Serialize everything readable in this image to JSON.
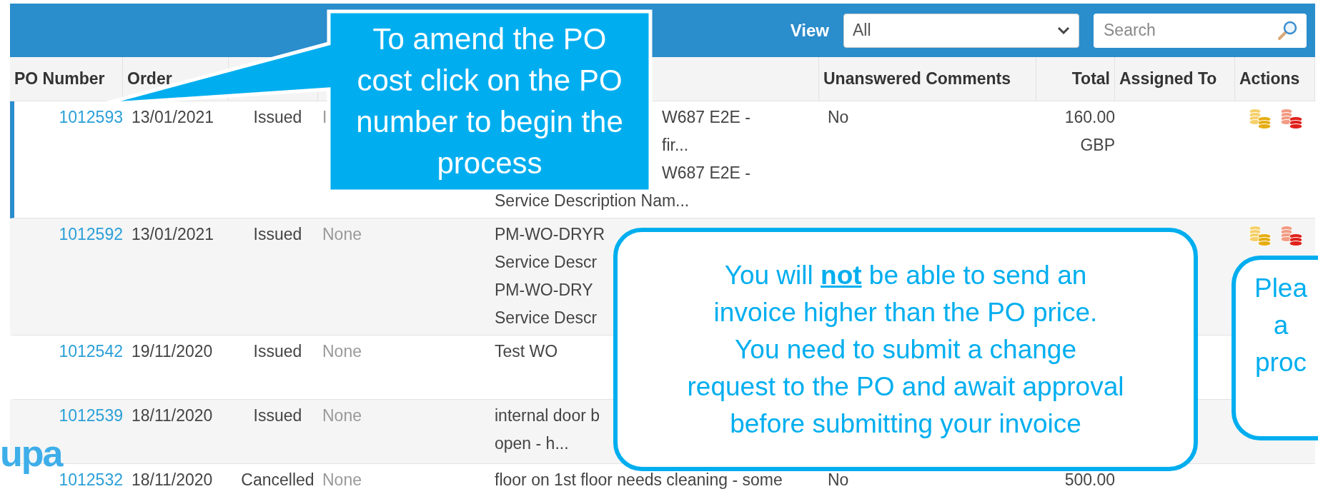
{
  "toolbar": {
    "view_label": "View",
    "view_select": {
      "value": "All"
    },
    "search": {
      "placeholder": "Search"
    }
  },
  "table": {
    "header": {
      "po_number": "PO Number",
      "order_date": "Order",
      "unanswered_comments": "Unanswered Comments",
      "total": "Total",
      "assigned_to": "Assigned To",
      "actions": "Actions"
    },
    "rows": [
      {
        "selected": true,
        "po_number": "1012593",
        "order_date": "13/01/2021",
        "status": "Issued",
        "column_4": "I",
        "description": [
          {
            "text": "W687 E2E -",
            "partly_hidden": true
          },
          {
            "text": "fir...",
            "partly_hidden": true
          },
          {
            "text": "W687 E2E -",
            "partly_hidden": true
          },
          {
            "text": "Service Description Nam...",
            "partly_hidden": false
          }
        ],
        "unanswered_comments": "No",
        "total": "160.00 GBP",
        "actions": [
          {
            "kind": "coins-gold"
          },
          {
            "kind": "coins-red"
          }
        ]
      },
      {
        "selected": false,
        "po_number": "1012592",
        "order_date": "13/01/2021",
        "status": "Issued",
        "column_4": "None",
        "description": [
          {
            "text": "PM-WO-DRYR",
            "partly_hidden": false
          },
          {
            "text": "Service Descr",
            "partly_hidden": false
          },
          {
            "text": "PM-WO-DRY",
            "partly_hidden": false
          },
          {
            "text": "Service Descr",
            "partly_hidden": false
          }
        ],
        "actions": [
          {
            "kind": "coins-gold"
          },
          {
            "kind": "coins-red"
          }
        ]
      },
      {
        "selected": false,
        "po_number": "1012542",
        "order_date": "19/11/2020",
        "status": "Issued",
        "column_4": "None",
        "description": [
          {
            "text": "Test WO",
            "partly_hidden": false
          }
        ]
      },
      {
        "selected": false,
        "po_number": "1012539",
        "order_date": "18/11/2020",
        "status": "Issued",
        "column_4": "None",
        "description": [
          {
            "text": "internal door b",
            "partly_hidden": false
          },
          {
            "text": "open - h...",
            "partly_hidden": false
          }
        ]
      },
      {
        "selected": false,
        "po_number": "1012532",
        "order_date": "18/11/2020",
        "status": "Cancelled",
        "column_4": "None",
        "description": [
          {
            "text": "floor on 1st floor needs cleaning - some",
            "partly_hidden": false
          }
        ],
        "unanswered_comments": "No",
        "total": "500.00"
      }
    ]
  },
  "callouts": [
    {
      "kind": "pointer",
      "text": "To amend the PO\ncost click on the PO\nnumber to begin the\nprocess"
    },
    {
      "kind": "rounded",
      "text": "You will **not** be able to send an\ninvoice higher than the PO price.\nYou need to submit a change\nrequest to the PO and await approval\nbefore submitting your invoice"
    },
    {
      "kind": "rounded",
      "text": "Plea\na\nproc"
    }
  ],
  "logo": {
    "text": "upa"
  }
}
